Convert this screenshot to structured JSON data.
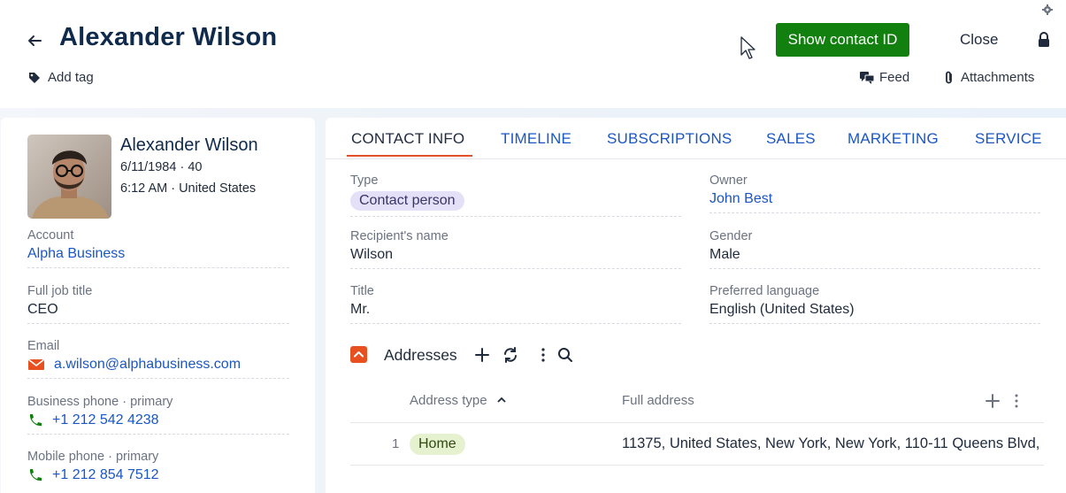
{
  "header": {
    "title": "Alexander Wilson",
    "add_tag": "Add tag",
    "show_contact_id": "Show contact ID",
    "close": "Close",
    "feed": "Feed",
    "attachments": "Attachments"
  },
  "profile": {
    "name": "Alexander Wilson",
    "birth_age": "6/11/1984 · 40",
    "time_location": "6:12 AM · United States"
  },
  "left_fields": [
    {
      "label": "Account",
      "value": "Alpha Business"
    },
    {
      "label": "Full job title",
      "value": "CEO"
    },
    {
      "label": "Email",
      "value": "a.wilson@alphabusiness.com"
    },
    {
      "label": "Business phone · primary",
      "value": "+1 212 542 4238"
    },
    {
      "label": "Mobile phone · primary",
      "value": "+1 212 854 7512"
    }
  ],
  "tabs": [
    "CONTACT INFO",
    "TIMELINE",
    "SUBSCRIPTIONS",
    "SALES",
    "MARKETING",
    "SERVICE"
  ],
  "main_fields": {
    "type": {
      "label": "Type",
      "value": "Contact person"
    },
    "owner": {
      "label": "Owner",
      "value": "John Best"
    },
    "recipient": {
      "label": "Recipient's name",
      "value": "Wilson"
    },
    "gender": {
      "label": "Gender",
      "value": "Male"
    },
    "title": {
      "label": "Title",
      "value": "Mr."
    },
    "language": {
      "label": "Preferred language",
      "value": "English (United States)"
    }
  },
  "addresses": {
    "title": "Addresses",
    "columns": {
      "type": "Address type",
      "full": "Full address"
    },
    "rows": [
      {
        "num": "1",
        "type": "Home",
        "full": "11375, United States, New York, New York, 110-11 Queens Blvd,"
      }
    ]
  },
  "colors": {
    "primary_button": "#12800f",
    "link": "#1a56c4",
    "accent": "#e0512b",
    "title": "#0f2a4a"
  },
  "icons": [
    "back-arrow-icon",
    "tag-icon",
    "gear-icon",
    "cursor-icon",
    "lock-icon",
    "feed-icon",
    "paperclip-icon",
    "mail-icon",
    "phone-icon",
    "chevron-up-icon",
    "plus-icon",
    "refresh-icon",
    "more-vertical-icon",
    "search-icon",
    "sort-up-icon"
  ]
}
